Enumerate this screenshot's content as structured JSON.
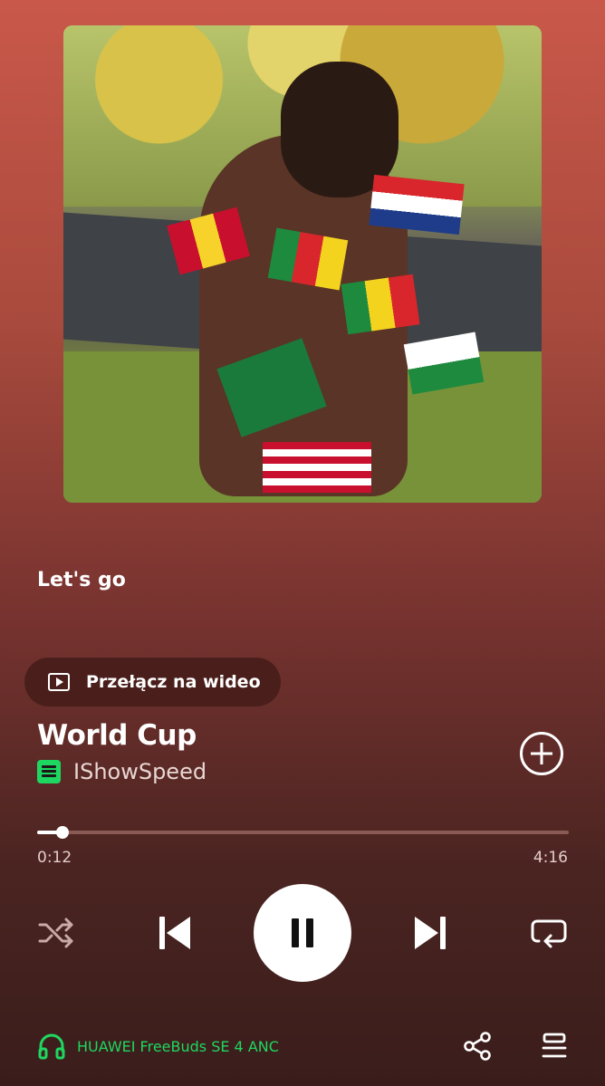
{
  "album_art": {
    "description_icon": "album-art"
  },
  "lyrics": {
    "title": "Let's go"
  },
  "video_toggle": {
    "label": "Przełącz na wideo"
  },
  "track": {
    "title": "World Cup",
    "artist": "IShowSpeed"
  },
  "progress": {
    "elapsed": "0:12",
    "duration": "4:16",
    "fraction": 0.047
  },
  "controls": {
    "shuffle": "shuffle-icon",
    "previous": "skip-previous-icon",
    "play_pause": "pause-icon",
    "next": "skip-next-icon",
    "repeat": "repeat-icon"
  },
  "footer": {
    "device_name": "HUAWEI FreeBuds SE 4 ANC",
    "share": "share-icon",
    "queue": "queue-icon"
  },
  "colors": {
    "accent_green": "#1ed760",
    "background_top": "#c9584a",
    "background_bottom": "#3a1d1b"
  }
}
